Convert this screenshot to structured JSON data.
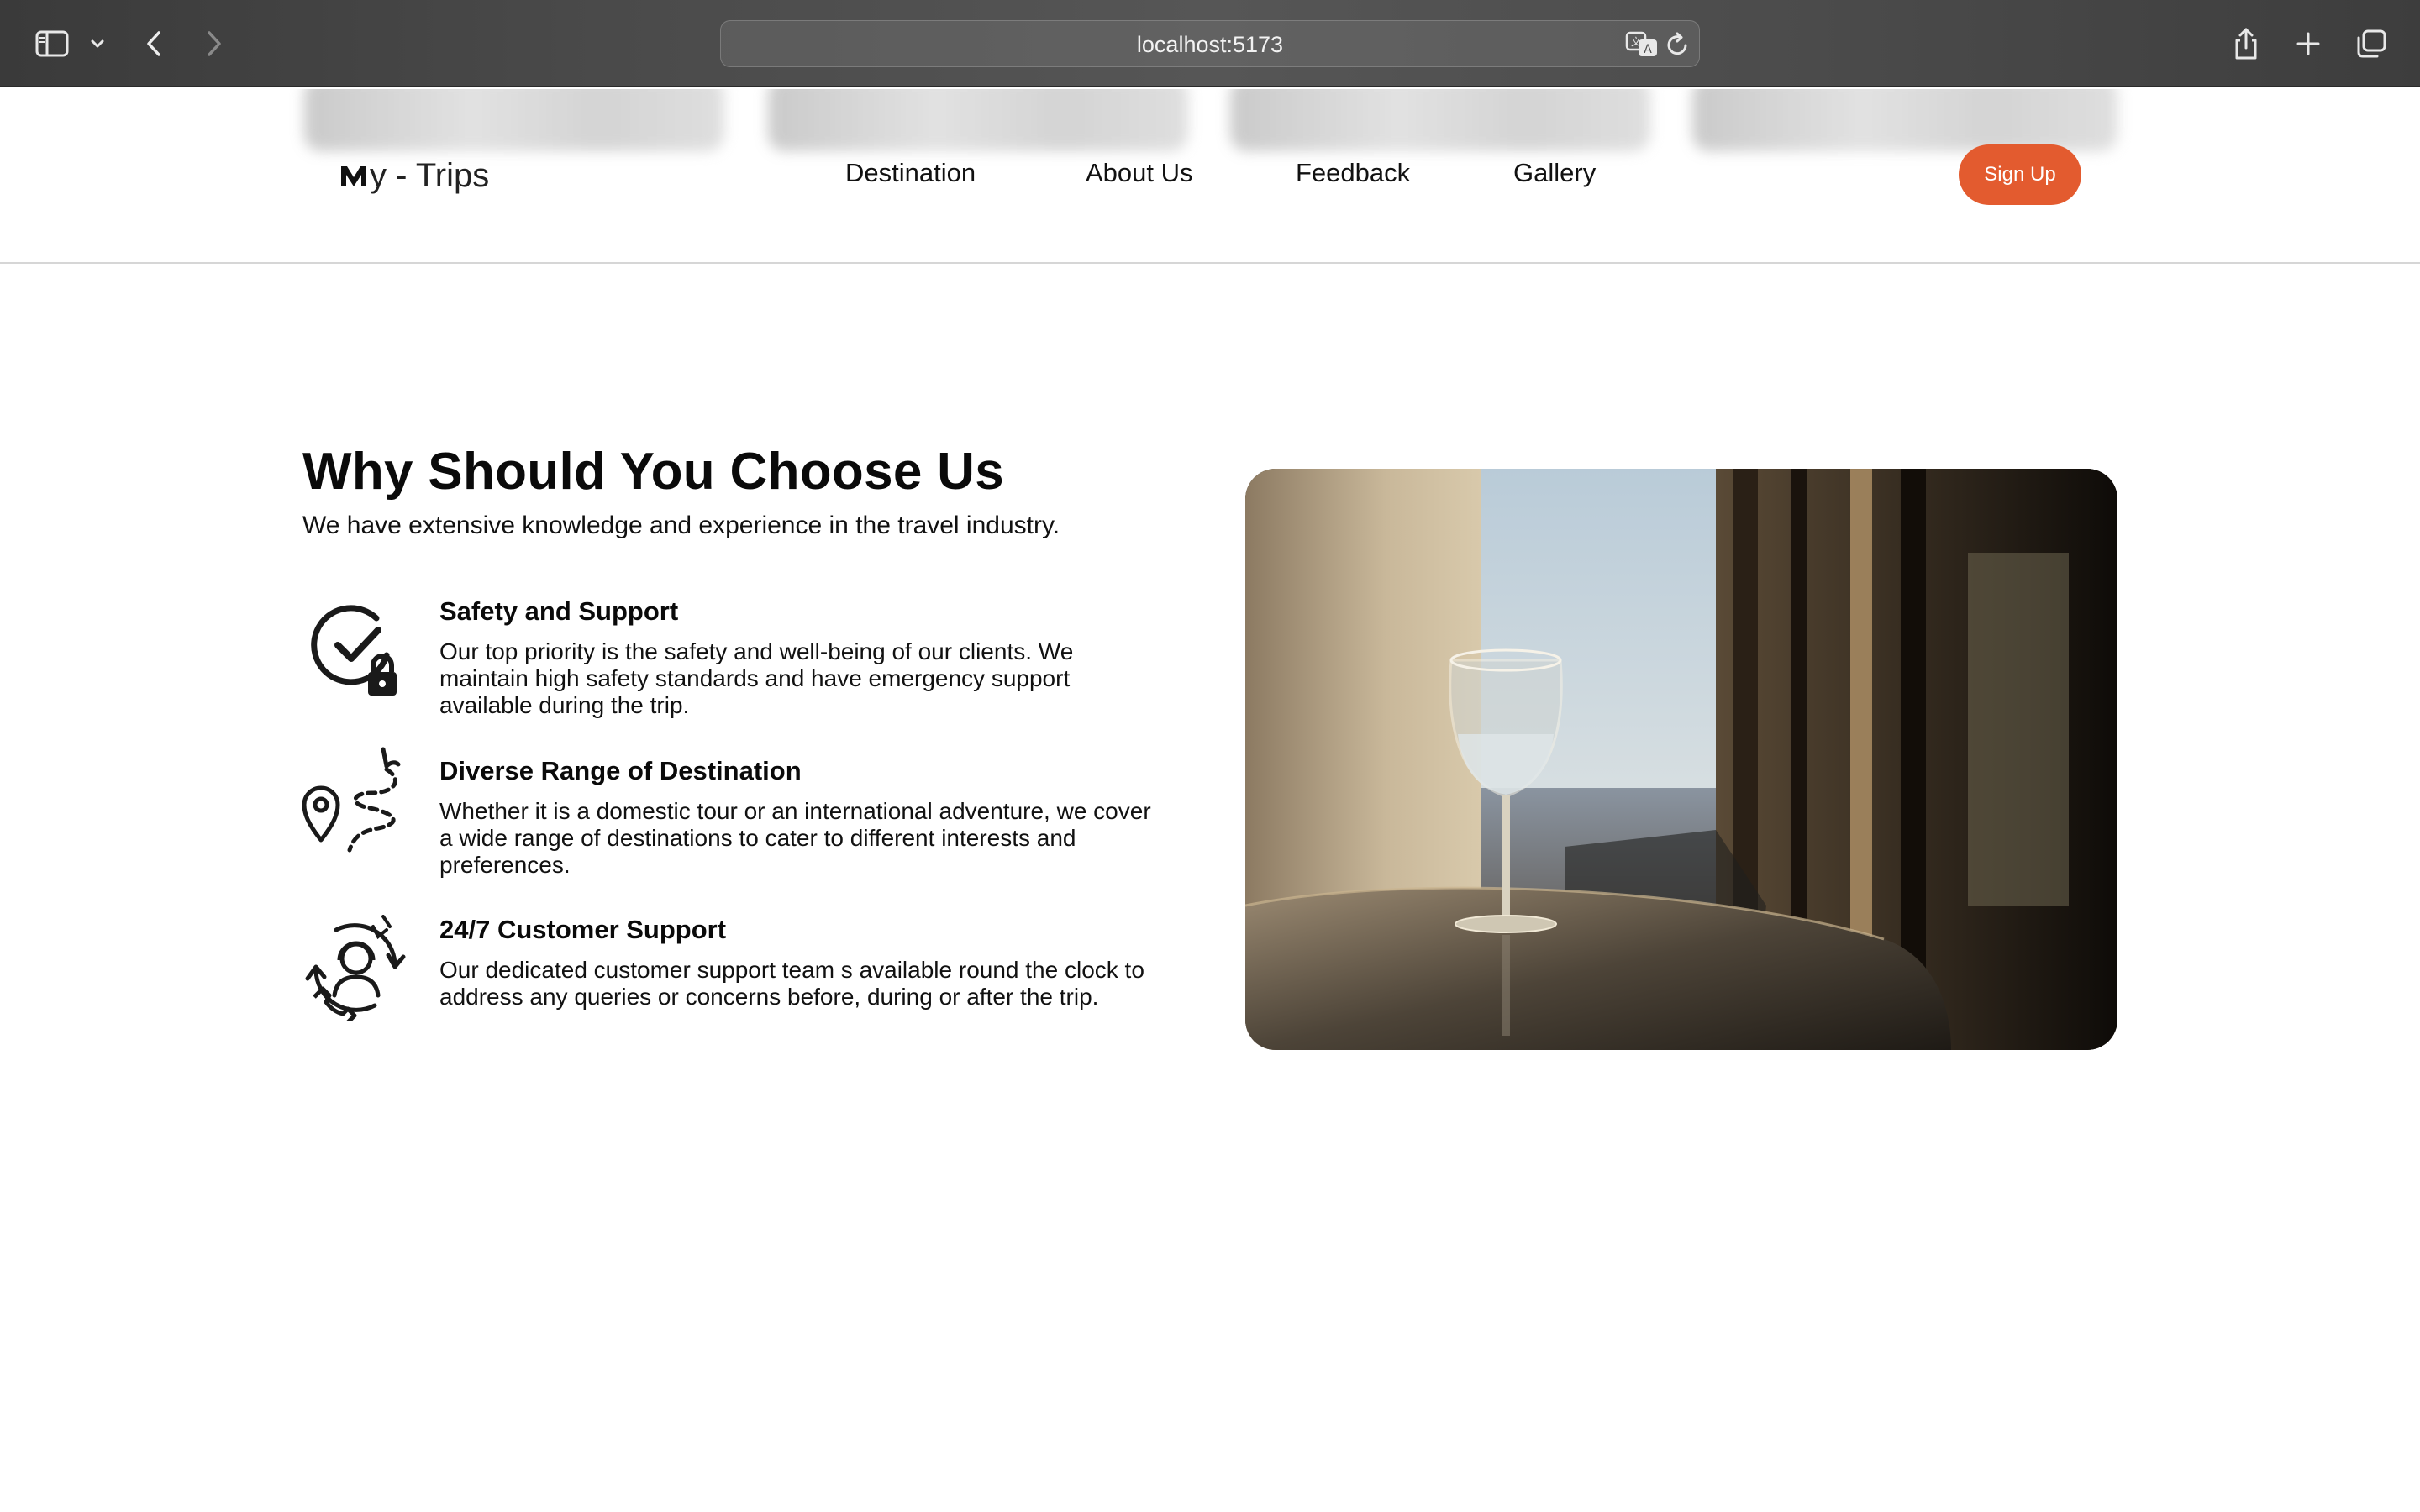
{
  "browser": {
    "url": "localhost:5173",
    "icons": [
      "sidebar-icon",
      "chevron-down-icon",
      "back-icon",
      "forward-icon",
      "translate-icon",
      "reload-icon",
      "share-icon",
      "new-tab-icon",
      "tabs-overview-icon"
    ]
  },
  "header": {
    "logo_text": "y - Trips",
    "nav": [
      "Destination",
      "About Us",
      "Feedback",
      "Gallery"
    ],
    "signup_label": "Sign Up"
  },
  "section": {
    "title": "Why Should You Choose Us",
    "subtitle": "We have extensive knowledge and experience in the travel industry.",
    "features": [
      {
        "icon": "shield-check-lock-icon",
        "title": "Safety and Support",
        "description": "Our top priority is the safety and well-being of our clients. We maintain high safety standards and have emergency support available during the trip."
      },
      {
        "icon": "route-pin-icon",
        "title": "Diverse Range of Destination",
        "description": "Whether it is a domestic tour or an international adventure, we cover a wide range of destinations to cater to different interests and preferences."
      },
      {
        "icon": "customer-support-icon",
        "title": "24/7 Customer Support",
        "description": "Our dedicated customer support team s available round the clock to address any queries or concerns before, during or after the trip."
      }
    ]
  },
  "colors": {
    "accent": "#e35b2f",
    "text": "#0a0a0a",
    "chrome": "#4a4a4a"
  }
}
